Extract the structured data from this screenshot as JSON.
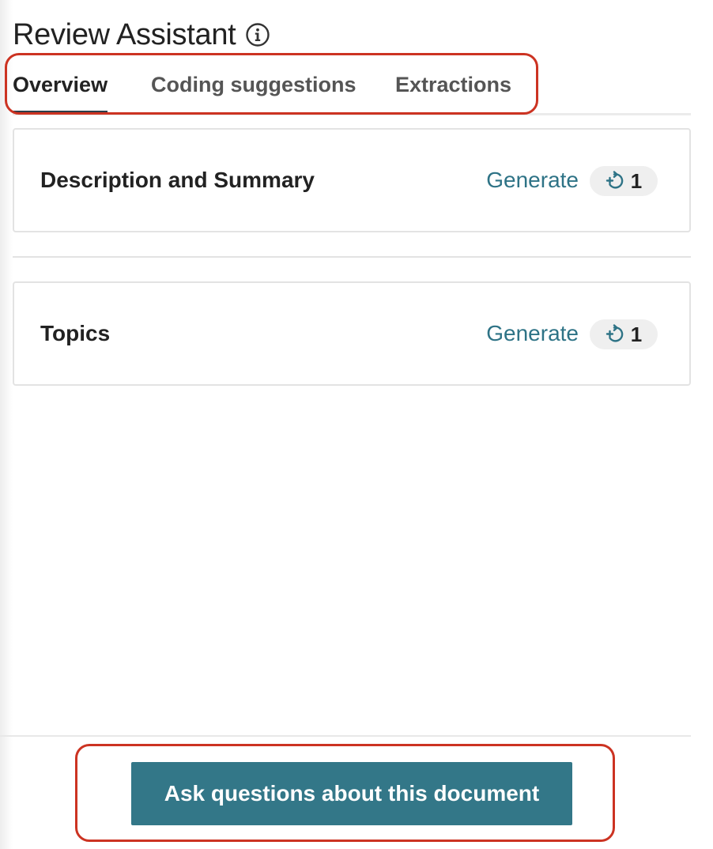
{
  "header": {
    "title": "Review Assistant",
    "info_icon": "info-circle-icon"
  },
  "tabs": [
    {
      "label": "Overview",
      "active": true
    },
    {
      "label": "Coding suggestions",
      "active": false
    },
    {
      "label": "Extractions",
      "active": false
    }
  ],
  "sections": [
    {
      "title": "Description and Summary",
      "action_label": "Generate",
      "count": "1",
      "count_icon": "plus-refresh-icon"
    },
    {
      "title": "Topics",
      "action_label": "Generate",
      "count": "1",
      "count_icon": "plus-refresh-icon"
    }
  ],
  "footer": {
    "button_label": "Ask questions about this document"
  },
  "colors": {
    "accent": "#337788",
    "link": "#2e7386",
    "highlight": "#cc3322",
    "active_tab_underline": "#2d3e4a"
  }
}
